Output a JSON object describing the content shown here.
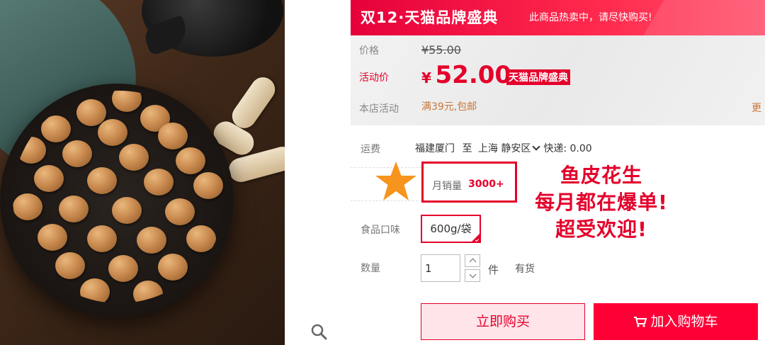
{
  "promo": {
    "title": "双12·天猫品牌盛典",
    "tagline": "此商品热卖中，请尽快购买!"
  },
  "price": {
    "label": "价格",
    "original": "¥55.00",
    "event_label": "活动价",
    "currency": "¥",
    "event_price": "52.00",
    "event_badge": "天猫品牌盛典",
    "store_label": "本店活动",
    "store_promo": "满39元,包邮",
    "more": "更"
  },
  "shipping": {
    "label": "运费",
    "from": "福建厦门",
    "to_word": "至",
    "dest": "上海 静安区",
    "express": "快递: 0.00"
  },
  "sales": {
    "label": "月销量",
    "count": "3000+"
  },
  "callout": {
    "line1": "鱼皮花生",
    "line2": "每月都在爆单!",
    "line3": "超受欢迎!"
  },
  "flavor": {
    "label": "食品口味",
    "selected": "600g/袋"
  },
  "quantity": {
    "label": "数量",
    "value": "1",
    "unit": "件",
    "stock": "有货"
  },
  "actions": {
    "buy_now": "立即购买",
    "add_cart": "加入购物车"
  },
  "colors": {
    "accent": "#e4002b",
    "cart_button": "#ff0036",
    "promo_orange": "#c9773a",
    "star": "#f7941d"
  },
  "icons": [
    "search-icon",
    "star-icon",
    "cart-icon",
    "chevron-down-icon"
  ]
}
